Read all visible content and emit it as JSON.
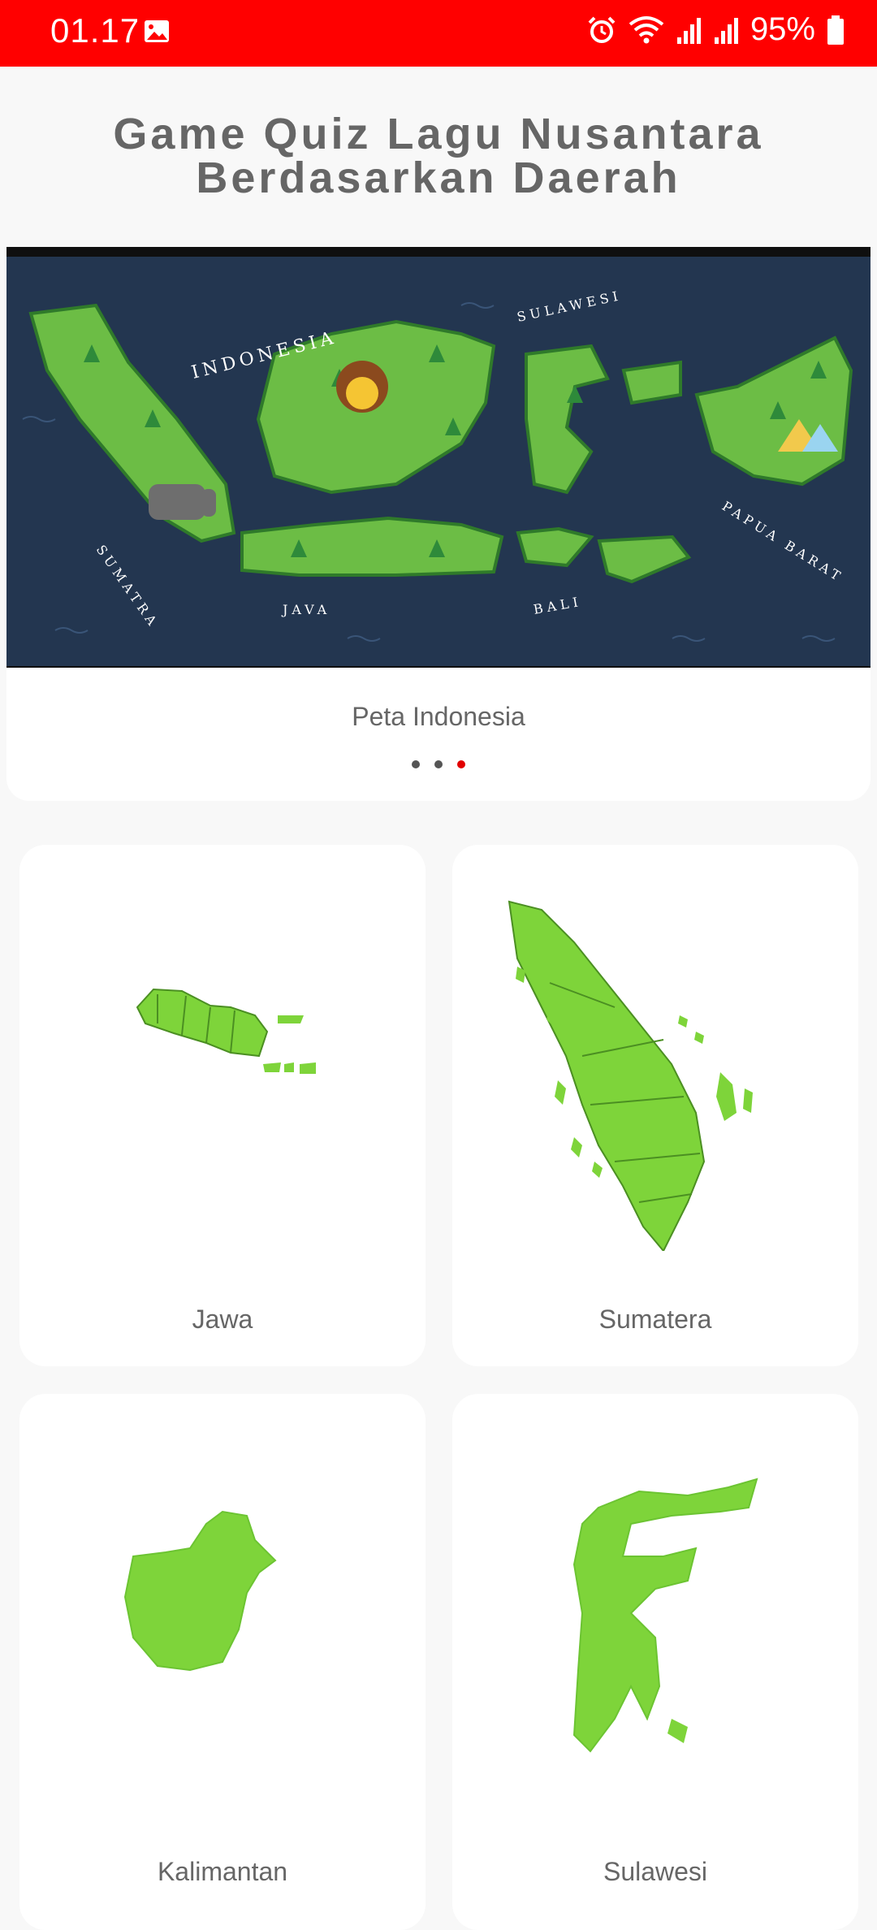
{
  "status_bar": {
    "time": "01.17",
    "battery": "95%",
    "icons": [
      "gallery-icon",
      "alarm-icon",
      "wifi-icon",
      "signal-icon",
      "signal-icon",
      "battery-icon"
    ]
  },
  "header": {
    "title_line1": "Game Quiz Lagu Nusantara",
    "title_line2": "Berdasarkan Daerah"
  },
  "carousel": {
    "caption": "Peta Indonesia",
    "map_labels": {
      "indonesia": "INDONESIA",
      "sumatra": "SUMATRA",
      "java": "JAVA",
      "sulawesi": "SULAWESI",
      "bali": "BALI",
      "papua": "PAPUA BARAT"
    },
    "page_count": 3,
    "active_page": 3
  },
  "regions": [
    {
      "label": "Jawa"
    },
    {
      "label": "Sumatera"
    },
    {
      "label": "Kalimantan"
    },
    {
      "label": "Sulawesi"
    }
  ],
  "colors": {
    "status_bar": "#ff0000",
    "island_green": "#7ed43a",
    "island_dark_green": "#6cc432",
    "map_background": "#233650",
    "active_dot": "#e20000"
  }
}
